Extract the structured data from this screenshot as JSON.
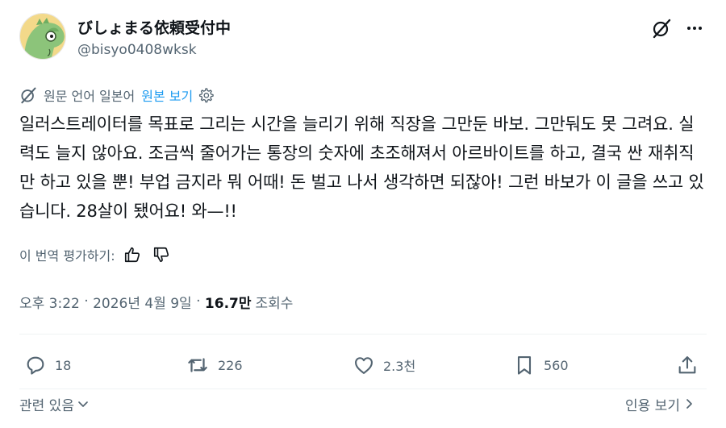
{
  "author": {
    "display_name": "びしょまる依頼受付中",
    "handle": "@bisyo0408wksk",
    "avatar_icon": "dinosaur-avatar-icon"
  },
  "header_actions": {
    "grok_icon": "grok-icon",
    "more_icon": "more-icon"
  },
  "translation": {
    "info": "원문 언어 일본어",
    "show_original": "원본 보기"
  },
  "tweet": {
    "text": "일러스트레이터를 목표로 그리는 시간을 늘리기 위해 직장을 그만둔 바보. 그만둬도 못 그려요. 실력도 늘지 않아요. 조금씩 줄어가는 통장의 숫자에 초조해져서 아르바이트를 하고, 결국 싼 재취직만 하고 있을 뿐! 부업 금지라 뭐 어때! 돈 벌고 나서 생각하면 되잖아! 그런 바보가 이 글을 쓰고 있습니다. 28살이 됐어요! 와—!!"
  },
  "rate_translation": {
    "label": "이 번역 평가하기:"
  },
  "meta": {
    "time": "오후 3:22",
    "date": "2026년 4월 9일",
    "views": "16.7만",
    "views_label": "조회수"
  },
  "actions": {
    "replies": "18",
    "reposts": "226",
    "likes": "2.3천",
    "bookmarks": "560"
  },
  "footer": {
    "related": "관련 있음",
    "quotes": "인용 보기"
  },
  "colors": {
    "text": "#0f1419",
    "muted": "#536471",
    "link": "#1d9bf0",
    "divider": "#eff3f4"
  }
}
